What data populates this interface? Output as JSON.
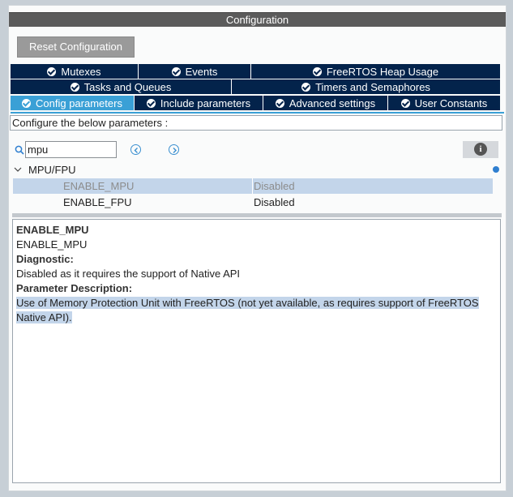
{
  "header": {
    "title": "Configuration"
  },
  "toolbar": {
    "reset_label": "Reset Configuration"
  },
  "tabs": {
    "row1": [
      {
        "label": "Mutexes"
      },
      {
        "label": "Events"
      },
      {
        "label": "FreeRTOS Heap Usage"
      }
    ],
    "row2": [
      {
        "label": "Tasks and Queues"
      },
      {
        "label": "Timers and Semaphores"
      }
    ],
    "row3": [
      {
        "label": "Config parameters",
        "active": true
      },
      {
        "label": "Include parameters"
      },
      {
        "label": "Advanced settings"
      },
      {
        "label": "User Constants"
      }
    ]
  },
  "info_line": "Configure the below parameters :",
  "search": {
    "value": "mpu"
  },
  "tree": {
    "group": "MPU/FPU",
    "params": [
      {
        "name": "ENABLE_MPU",
        "value": "Disabled",
        "selected": true
      },
      {
        "name": "ENABLE_FPU",
        "value": "Disabled",
        "selected": false
      }
    ]
  },
  "description": {
    "title": "ENABLE_MPU",
    "name": "ENABLE_MPU",
    "diagnostic_label": "Diagnostic:",
    "diagnostic_text": "Disabled as it requires the support of Native API",
    "param_desc_label": "Parameter Description:",
    "param_desc_line1": "Use of Memory Protection Unit with FreeRTOS (not yet available, as requires support of FreeRTOS",
    "param_desc_line2": "Native API)."
  },
  "colors": {
    "tab_bg": "#03234b",
    "tab_active": "#3aa0d6",
    "title_bg": "#5b5b5b",
    "selection": "#c3d5ea"
  },
  "icons": [
    "check-circle-icon",
    "search-icon",
    "chevron-left-icon",
    "chevron-right-icon",
    "info-icon",
    "chevron-down-icon"
  ]
}
